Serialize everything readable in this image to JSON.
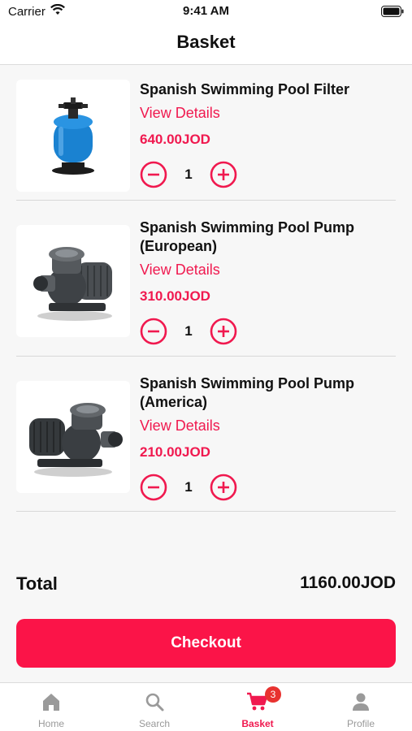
{
  "status_bar": {
    "carrier": "Carrier",
    "time": "9:41 AM"
  },
  "header": {
    "title": "Basket"
  },
  "items": [
    {
      "name": "Spanish Swimming Pool Filter",
      "link": "View Details",
      "price": "640.00JOD",
      "quantity": "1",
      "image": "sand-filter-image"
    },
    {
      "name": "Spanish Swimming Pool Pump (European)",
      "link": "View Details",
      "price": "310.00JOD",
      "quantity": "1",
      "image": "pool-pump-image"
    },
    {
      "name": "Spanish Swimming Pool Pump (America)",
      "link": "View Details",
      "price": "210.00JOD",
      "quantity": "1",
      "image": "pool-pump-image"
    }
  ],
  "summary": {
    "total_label": "Total",
    "total_value": "1160.00JOD"
  },
  "checkout": {
    "label": "Checkout"
  },
  "tabs": [
    {
      "label": "Home",
      "icon": "home-icon"
    },
    {
      "label": "Search",
      "icon": "search-icon"
    },
    {
      "label": "Basket",
      "icon": "cart-icon",
      "badge": "3",
      "active": true
    },
    {
      "label": "Profile",
      "icon": "person-icon"
    }
  ],
  "colors": {
    "accent": "#f0194f",
    "checkout": "#fb1448",
    "badge": "#e8322f",
    "background": "#f7f7f7"
  }
}
